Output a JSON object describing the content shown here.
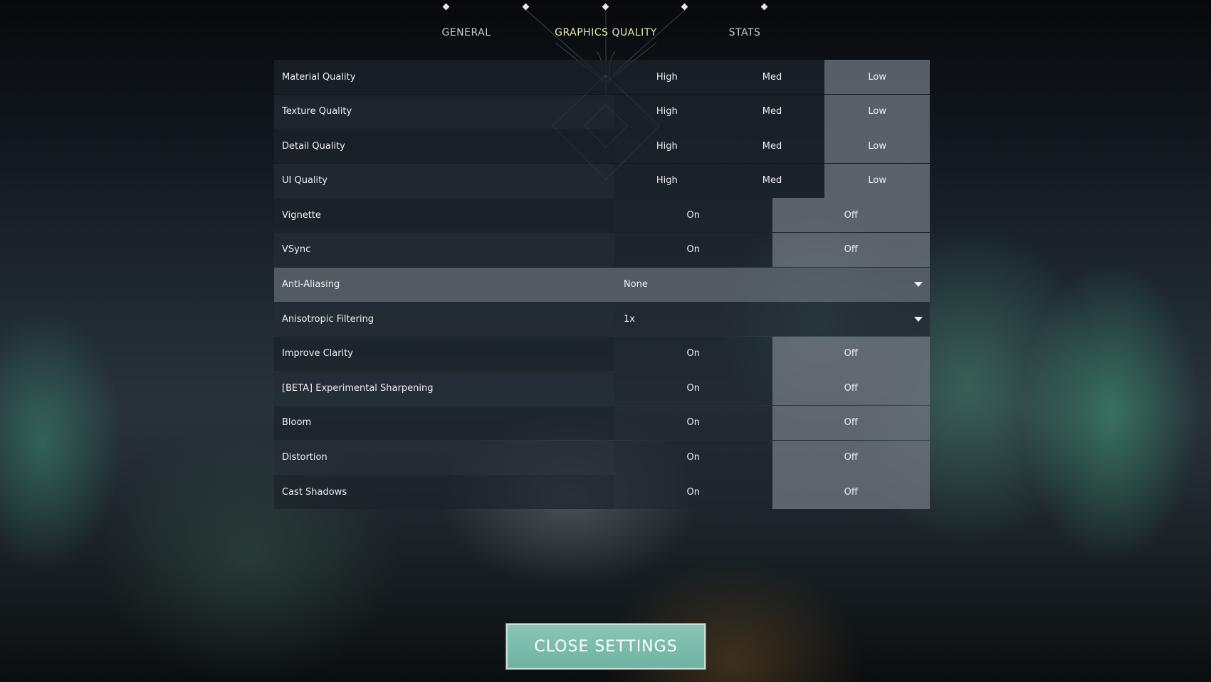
{
  "tabs": {
    "general": "GENERAL",
    "graphics": "GRAPHICS QUALITY",
    "stats": "STATS",
    "active": "GRAPHICS QUALITY"
  },
  "settings": [
    {
      "label": "Material Quality",
      "type": "toggle",
      "options": [
        "High",
        "Med",
        "Low"
      ],
      "selected": "Low"
    },
    {
      "label": "Texture Quality",
      "type": "toggle",
      "options": [
        "High",
        "Med",
        "Low"
      ],
      "selected": "Low"
    },
    {
      "label": "Detail Quality",
      "type": "toggle",
      "options": [
        "High",
        "Med",
        "Low"
      ],
      "selected": "Low"
    },
    {
      "label": "UI Quality",
      "type": "toggle",
      "options": [
        "High",
        "Med",
        "Low"
      ],
      "selected": "Low"
    },
    {
      "label": "Vignette",
      "type": "toggle",
      "options": [
        "On",
        "Off"
      ],
      "selected": "Off"
    },
    {
      "label": "VSync",
      "type": "toggle",
      "options": [
        "On",
        "Off"
      ],
      "selected": "Off"
    },
    {
      "label": "Anti-Aliasing",
      "type": "dropdown",
      "value": "None",
      "highlighted": true
    },
    {
      "label": "Anisotropic Filtering",
      "type": "dropdown",
      "value": "1x"
    },
    {
      "label": "Improve Clarity",
      "type": "toggle",
      "options": [
        "On",
        "Off"
      ],
      "selected": "Off"
    },
    {
      "label": "[BETA] Experimental Sharpening",
      "type": "toggle",
      "options": [
        "On",
        "Off"
      ],
      "selected": "Off"
    },
    {
      "label": "Bloom",
      "type": "toggle",
      "options": [
        "On",
        "Off"
      ],
      "selected": "Off"
    },
    {
      "label": "Distortion",
      "type": "toggle",
      "options": [
        "On",
        "Off"
      ],
      "selected": "Off"
    },
    {
      "label": "Cast Shadows",
      "type": "toggle",
      "options": [
        "On",
        "Off"
      ],
      "selected": "Off"
    }
  ],
  "close_button": {
    "label": "CLOSE SETTINGS"
  },
  "colors": {
    "active_tab": "#ece8b4",
    "close_button": "#79bcac",
    "selected_option": "#6e747c"
  },
  "icons": {
    "tab_marker": "diamond-icon",
    "dropdown": "chevron-down-icon",
    "emblem": "valorant-emblem-icon"
  }
}
